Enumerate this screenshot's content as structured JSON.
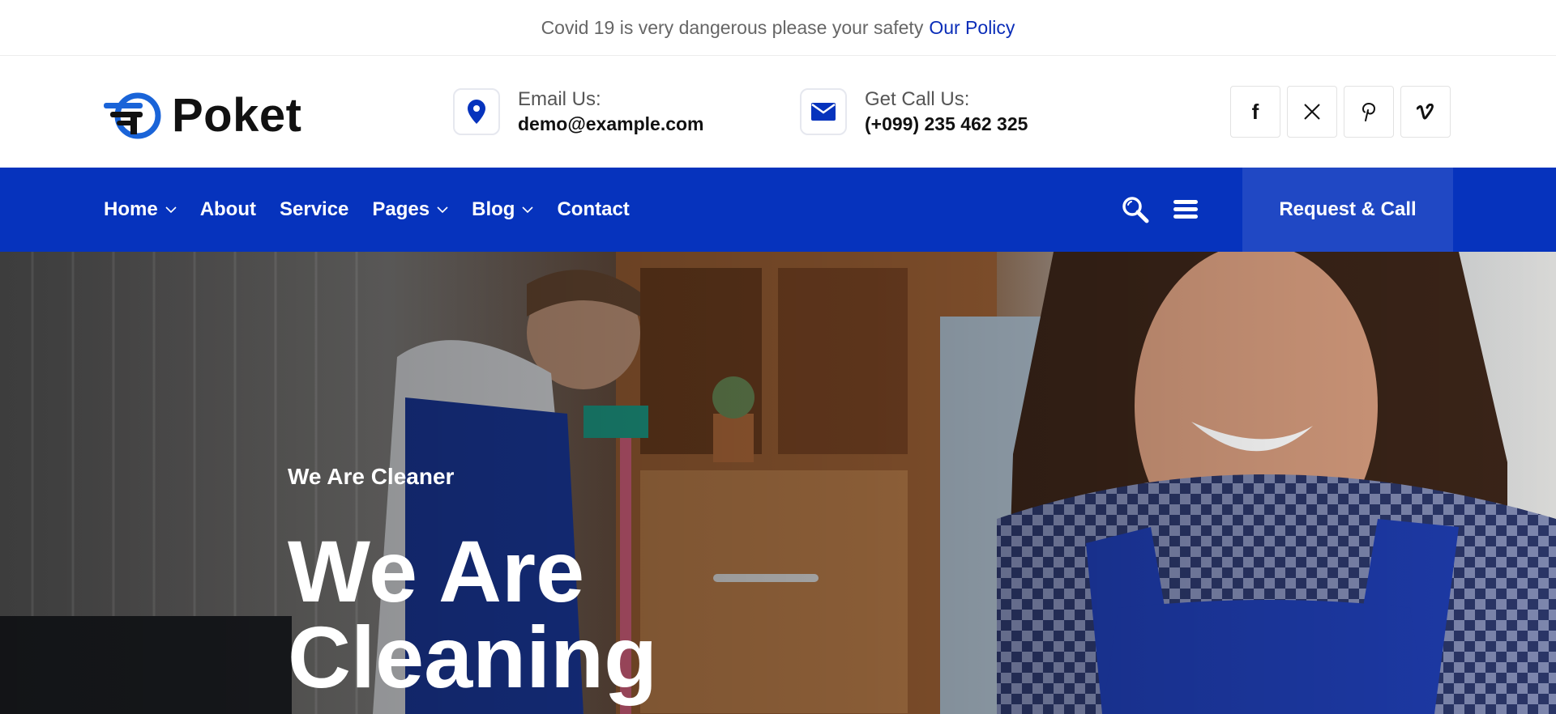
{
  "topbar": {
    "notice": "Covid 19 is very dangerous please your safety",
    "policy_link": "Our Policy"
  },
  "header": {
    "logo_text": "Poket",
    "email": {
      "label": "Email Us:",
      "value": "demo@example.com",
      "icon": "location-pin-icon"
    },
    "phone": {
      "label": "Get Call Us:",
      "value": "(+099) 235 462 325",
      "icon": "envelope-icon"
    },
    "social": [
      {
        "name": "facebook",
        "glyph": "f"
      },
      {
        "name": "x",
        "glyph": "X"
      },
      {
        "name": "pinterest",
        "glyph": "P"
      },
      {
        "name": "vimeo",
        "glyph": "v"
      }
    ]
  },
  "nav": {
    "items": [
      {
        "label": "Home",
        "has_dropdown": true
      },
      {
        "label": "About",
        "has_dropdown": false
      },
      {
        "label": "Service",
        "has_dropdown": false
      },
      {
        "label": "Pages",
        "has_dropdown": true
      },
      {
        "label": "Blog",
        "has_dropdown": true
      },
      {
        "label": "Contact",
        "has_dropdown": false
      }
    ],
    "search_icon": "search-icon",
    "menu_icon": "hamburger-menu-icon",
    "cta_label": "Request & Call"
  },
  "hero": {
    "subtitle": "We Are Cleaner",
    "title_line1": "We Are",
    "title_line2": "Cleaning"
  },
  "colors": {
    "primary": "#0633bd",
    "cta": "#2048c4",
    "link": "#0a2db8"
  }
}
